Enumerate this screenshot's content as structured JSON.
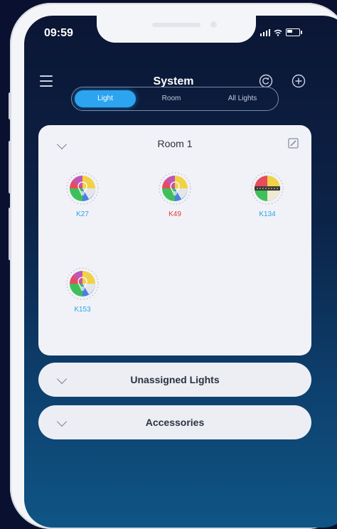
{
  "status_bar": {
    "time": "09:59"
  },
  "nav": {
    "title": "System",
    "menu_icon": "hamburger-icon",
    "refresh_icon": "refresh-icon",
    "add_icon": "add-icon"
  },
  "tabs": [
    {
      "label": "Light",
      "active": true
    },
    {
      "label": "Room",
      "active": false
    },
    {
      "label": "All Lights",
      "active": false
    }
  ],
  "room": {
    "title": "Room 1",
    "edit_icon": "edit-icon",
    "lights": [
      {
        "label": "K27",
        "label_color": "#2aa3ea",
        "icon": "rgbw-bulb-icon"
      },
      {
        "label": "K49",
        "label_color": "#e83a3a",
        "icon": "rgbw-bulb-icon"
      },
      {
        "label": "K134",
        "label_color": "#2aa3ea",
        "icon": "rgbw-strip-icon"
      },
      {
        "label": "K153",
        "label_color": "#2aa3ea",
        "icon": "rgbw-bulb-icon"
      }
    ]
  },
  "sections": [
    {
      "title": "Unassigned Lights",
      "expanded": false
    },
    {
      "title": "Accessories",
      "expanded": false
    }
  ],
  "colors": {
    "accent": "#2da4ef",
    "background_top": "#0b1634",
    "background_bottom": "#0f5585"
  }
}
